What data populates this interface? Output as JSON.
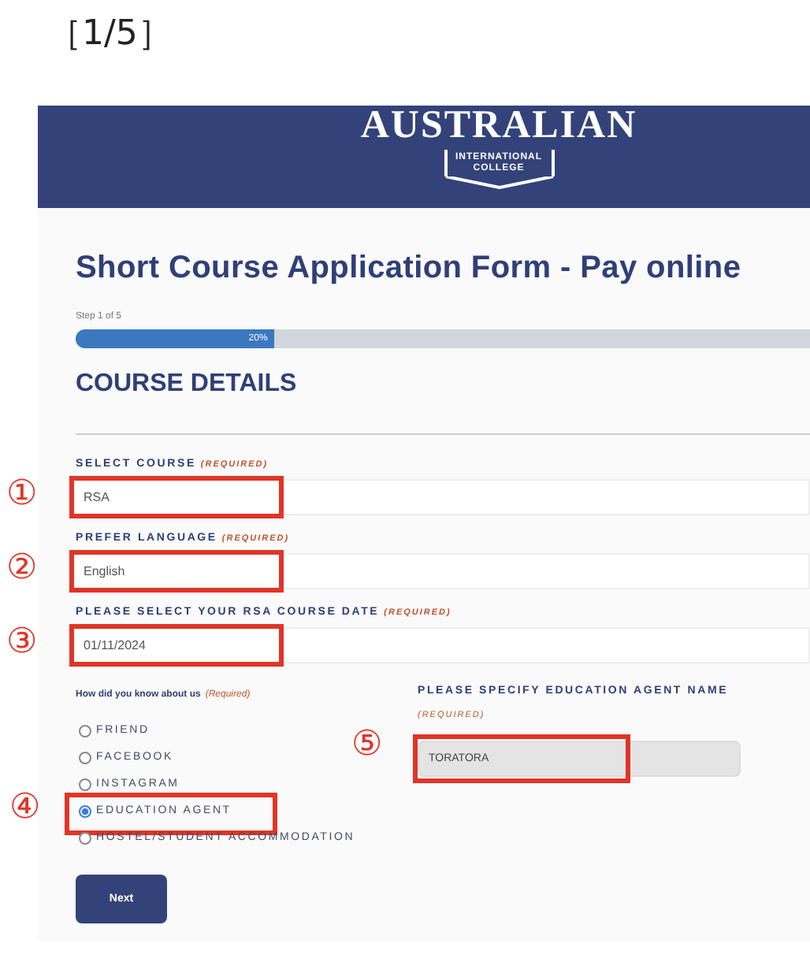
{
  "caption": "［1/5］",
  "header": {
    "logo_main": "AUSTRALIAN",
    "logo_line_1": "INTERNATIONAL",
    "logo_line_2": "COLLEGE"
  },
  "form": {
    "title": "Short Course Application Form - Pay online",
    "step": "Step 1 of 5",
    "progress": {
      "level": 0.27,
      "label": "20%"
    },
    "section": "COURSE DETAILS",
    "fields": [
      {
        "label": "SELECT COURSE",
        "required": "(REQUIRED)",
        "value": "RSA",
        "annotation": "①"
      },
      {
        "label": "PREFER LANGUAGE",
        "required": "(REQUIRED)",
        "value": "English",
        "annotation": "②"
      },
      {
        "label": "PLEASE SELECT YOUR RSA COURSE DATE",
        "required": "(REQUIRED)",
        "value": "01/11/2024",
        "annotation": "③"
      }
    ],
    "source": {
      "label": "How did you know about us",
      "required": "(Required)",
      "options": [
        {
          "label": "FRIEND",
          "selected": false
        },
        {
          "label": "FACEBOOK",
          "selected": false
        },
        {
          "label": "INSTAGRAM",
          "selected": false
        },
        {
          "label": "EDUCATION AGENT",
          "selected": true,
          "annotation": "④"
        },
        {
          "label": "HOSTEL/STUDENT ACCOMMODATION",
          "selected": false
        }
      ]
    },
    "agent": {
      "label": "PLEASE SPECIFY EDUCATION AGENT NAME",
      "required": "(REQUIRED)",
      "value": "TORATORA",
      "annotation": "⑤"
    },
    "button": "Next"
  }
}
